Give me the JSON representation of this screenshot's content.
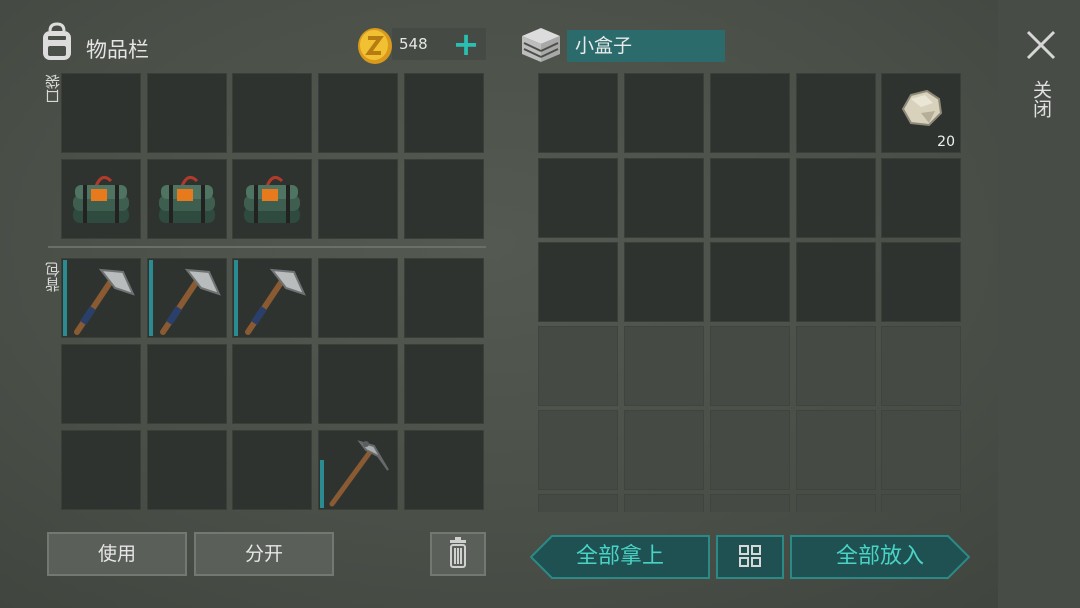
{
  "inventory": {
    "title": "物品栏",
    "pocket_label": "口袋",
    "backpack_label": "背包",
    "coins": "548",
    "use_label": "使用",
    "split_label": "分开"
  },
  "container": {
    "name": "小盒子",
    "stone_count": "20",
    "take_all_label": "全部拿上",
    "put_all_label": "全部放入"
  },
  "close": {
    "label": "关闭"
  },
  "colors": {
    "accent": "#2bbfb3",
    "slot_dark": "#2f3330",
    "teal_panel": "#2c6b6c"
  },
  "items": {
    "pocket": [
      "",
      "",
      "",
      "",
      "",
      "c4-explosive",
      "c4-explosive",
      "c4-explosive",
      "",
      ""
    ],
    "backpack": [
      "stone-hatchet",
      "stone-hatchet",
      "stone-hatchet",
      "",
      "",
      "",
      "",
      "",
      "",
      "",
      "",
      "",
      "",
      "stone-pickaxe",
      ""
    ],
    "box_first_slot": "stone"
  }
}
